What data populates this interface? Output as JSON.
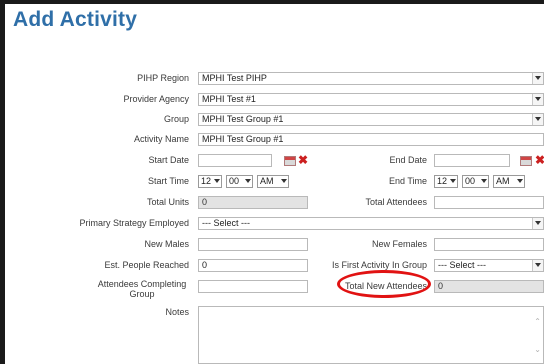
{
  "page": {
    "title": "Add Activity"
  },
  "form": {
    "pihp_region": {
      "label": "PIHP Region",
      "value": "MPHI Test PIHP"
    },
    "provider_agency": {
      "label": "Provider Agency",
      "value": "MPHI Test #1"
    },
    "group": {
      "label": "Group",
      "value": "MPHI Test Group #1"
    },
    "activity_name": {
      "label": "Activity Name",
      "value": "MPHI Test Group #1"
    },
    "start_date": {
      "label": "Start Date",
      "value": ""
    },
    "end_date": {
      "label": "End Date",
      "value": ""
    },
    "start_time": {
      "label": "Start Time",
      "hour": "12",
      "minute": "00",
      "ampm": "AM"
    },
    "end_time": {
      "label": "End Time",
      "hour": "12",
      "minute": "00",
      "ampm": "AM"
    },
    "total_units": {
      "label": "Total Units",
      "value": "0"
    },
    "total_attendees": {
      "label": "Total Attendees",
      "value": ""
    },
    "primary_strategy": {
      "label": "Primary Strategy Employed",
      "value": "--- Select ---"
    },
    "new_males": {
      "label": "New Males",
      "value": ""
    },
    "new_females": {
      "label": "New Females",
      "value": ""
    },
    "est_people_reached": {
      "label": "Est. People Reached",
      "value": "0"
    },
    "is_first_activity": {
      "label": "Is First Activity In Group",
      "value": "--- Select ---"
    },
    "attendees_completing": {
      "label": "Attendees Completing Group",
      "value": ""
    },
    "total_new_attendees": {
      "label": "Total New Attendees",
      "value": "0"
    },
    "notes": {
      "label": "Notes",
      "value": ""
    }
  },
  "colors": {
    "title": "#2f6fa8",
    "highlight": "#e11212"
  },
  "icons": {
    "calendar": "calendar-icon",
    "clear": "clear-x-icon",
    "dropdown": "chevron-down-icon"
  }
}
